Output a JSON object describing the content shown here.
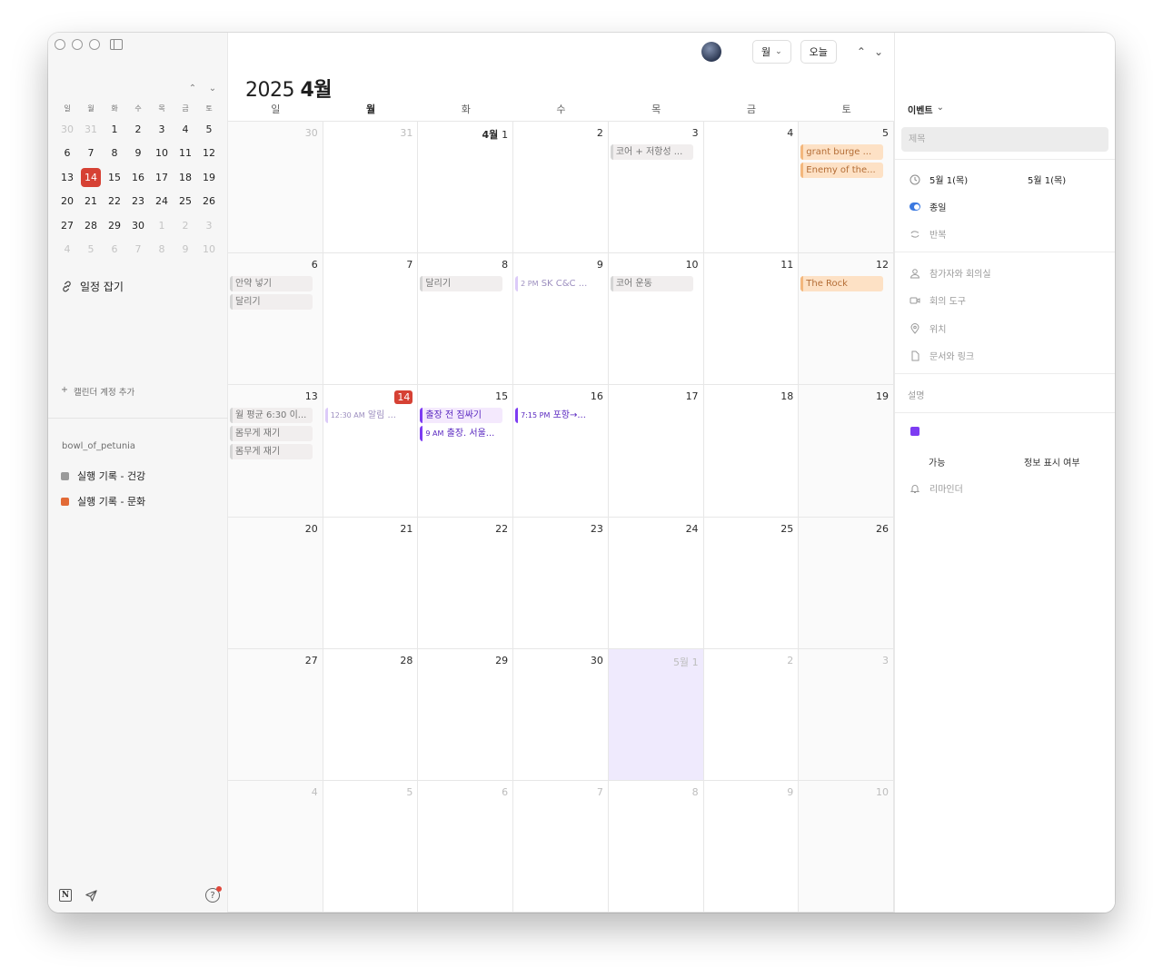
{
  "sidebar": {
    "mini_weekdays": [
      "일",
      "월",
      "화",
      "수",
      "목",
      "금",
      "토"
    ],
    "mini_prev_icon": "chevron-up-icon",
    "mini_next_icon": "chevron-down-icon",
    "mini_days": [
      [
        {
          "d": "30",
          "o": true
        },
        {
          "d": "31",
          "o": true
        },
        {
          "d": "1"
        },
        {
          "d": "2"
        },
        {
          "d": "3"
        },
        {
          "d": "4"
        },
        {
          "d": "5"
        }
      ],
      [
        {
          "d": "6"
        },
        {
          "d": "7"
        },
        {
          "d": "8"
        },
        {
          "d": "9"
        },
        {
          "d": "10"
        },
        {
          "d": "11"
        },
        {
          "d": "12"
        }
      ],
      [
        {
          "d": "13"
        },
        {
          "d": "14",
          "today": true
        },
        {
          "d": "15"
        },
        {
          "d": "16"
        },
        {
          "d": "17"
        },
        {
          "d": "18"
        },
        {
          "d": "19"
        }
      ],
      [
        {
          "d": "20"
        },
        {
          "d": "21"
        },
        {
          "d": "22"
        },
        {
          "d": "23"
        },
        {
          "d": "24"
        },
        {
          "d": "25"
        },
        {
          "d": "26"
        }
      ],
      [
        {
          "d": "27"
        },
        {
          "d": "28"
        },
        {
          "d": "29"
        },
        {
          "d": "30"
        },
        {
          "d": "1",
          "o": true
        },
        {
          "d": "2",
          "o": true
        },
        {
          "d": "3",
          "o": true
        }
      ],
      [
        {
          "d": "4",
          "o": true
        },
        {
          "d": "5",
          "o": true
        },
        {
          "d": "6",
          "o": true
        },
        {
          "d": "7",
          "o": true
        },
        {
          "d": "8",
          "o": true
        },
        {
          "d": "9",
          "o": true
        },
        {
          "d": "10",
          "o": true
        }
      ]
    ],
    "schedule_link": "일정 잡기",
    "add_account": "캘린더 계정 추가",
    "account_name": "bowl_of_petunia",
    "calendars": [
      {
        "name": "실행 기록 - 건강",
        "color": "#9a9a9a"
      },
      {
        "name": "실행 기록 - 문화",
        "color": "#e26a36"
      }
    ]
  },
  "toolbar": {
    "view_label": "월",
    "today_label": "오늘"
  },
  "header": {
    "year": "2025",
    "month": "4월"
  },
  "weekdays": [
    "일",
    "월",
    "화",
    "수",
    "목",
    "금",
    "토"
  ],
  "weeks": [
    [
      {
        "n": "30",
        "other": true
      },
      {
        "n": "31",
        "other": true
      },
      {
        "n": "1",
        "prefix": "4월 "
      },
      {
        "n": "2"
      },
      {
        "n": "3",
        "events": [
          {
            "text": "코어 + 저항성 ...",
            "style": "gray"
          }
        ]
      },
      {
        "n": "4"
      },
      {
        "n": "5",
        "events": [
          {
            "text": "grant burge ...",
            "style": "orange"
          },
          {
            "text": "Enemy of the...",
            "style": "orange"
          }
        ]
      }
    ],
    [
      {
        "n": "6",
        "events": [
          {
            "text": "안약 넣기",
            "style": "gray"
          },
          {
            "text": "달리기",
            "style": "gray"
          }
        ]
      },
      {
        "n": "7"
      },
      {
        "n": "8",
        "events": [
          {
            "text": "달리기",
            "style": "gray"
          }
        ]
      },
      {
        "n": "9",
        "events": [
          {
            "time": "2 PM",
            "text": "SK C&C ...",
            "style": "faded"
          }
        ]
      },
      {
        "n": "10",
        "events": [
          {
            "text": "코어 운동",
            "style": "gray"
          }
        ]
      },
      {
        "n": "11"
      },
      {
        "n": "12",
        "events": [
          {
            "text": "The Rock",
            "style": "orange"
          }
        ]
      }
    ],
    [
      {
        "n": "13",
        "events": [
          {
            "text": "월 평균 6:30 이...",
            "style": "gray"
          },
          {
            "text": "몸무게 재기",
            "style": "gray"
          },
          {
            "text": "몸무게 재기",
            "style": "gray"
          }
        ]
      },
      {
        "n": "14",
        "today": true,
        "events": [
          {
            "time": "12:30 AM",
            "text": "알림 ...",
            "style": "faded"
          }
        ]
      },
      {
        "n": "15",
        "events": [
          {
            "text": "출장 전 짐싸기",
            "style": "purple"
          },
          {
            "time": "9 AM",
            "text": "출장. 서울...",
            "style": "plain-purple"
          }
        ]
      },
      {
        "n": "16",
        "events": [
          {
            "time": "7:15 PM",
            "text": "포항→...",
            "style": "plain-purple"
          }
        ]
      },
      {
        "n": "17"
      },
      {
        "n": "18"
      },
      {
        "n": "19"
      }
    ],
    [
      {
        "n": "20"
      },
      {
        "n": "21"
      },
      {
        "n": "22"
      },
      {
        "n": "23"
      },
      {
        "n": "24"
      },
      {
        "n": "25"
      },
      {
        "n": "26"
      }
    ],
    [
      {
        "n": "27"
      },
      {
        "n": "28"
      },
      {
        "n": "29"
      },
      {
        "n": "30"
      },
      {
        "n": "1",
        "prefix": "5월 ",
        "other": true,
        "selected": true
      },
      {
        "n": "2",
        "other": true
      },
      {
        "n": "3",
        "other": true
      }
    ],
    [
      {
        "n": "4",
        "other": true
      },
      {
        "n": "5",
        "other": true
      },
      {
        "n": "6",
        "other": true
      },
      {
        "n": "7",
        "other": true
      },
      {
        "n": "8",
        "other": true
      },
      {
        "n": "9",
        "other": true
      },
      {
        "n": "10",
        "other": true
      }
    ]
  ],
  "panel": {
    "type_label": "이벤트",
    "title_placeholder": "제목",
    "start_date": "5월 1(목)",
    "end_date": "5월 1(목)",
    "all_day_label": "종일",
    "repeat_label": "반복",
    "participants_label": "참가자와 회의실",
    "meeting_tool_label": "회의 도구",
    "location_label": "위치",
    "docs_label": "문서와 링크",
    "description_label": "설명",
    "event_color": "#7d3cf2",
    "availability_label": "가능",
    "visibility_label": "정보 표시 여부",
    "reminder_label": "리마인더"
  }
}
